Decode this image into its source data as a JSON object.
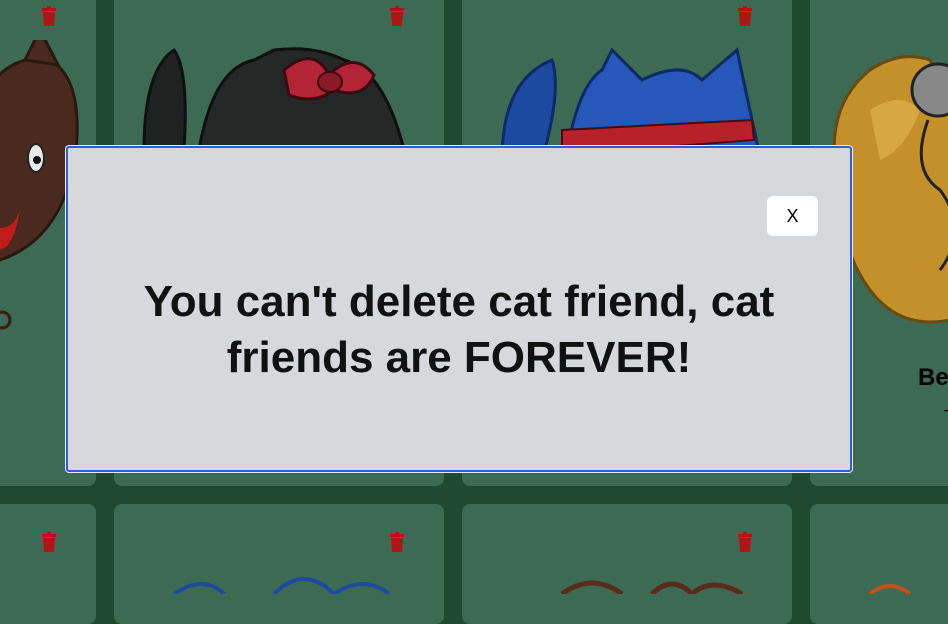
{
  "cards": [
    {
      "name": "",
      "subtitle": ""
    },
    {
      "name": "",
      "subtitle": ""
    },
    {
      "name": "",
      "subtitle": ""
    },
    {
      "name": "Be",
      "subtitle": "T"
    }
  ],
  "modal": {
    "close_label": "X",
    "message": "You can't delete cat friend, cat friends are FOREVER!"
  },
  "colors": {
    "background": "#1f4a30",
    "card": "#3c6a52",
    "trash": "#b01515",
    "modal_bg": "#d6d8dc",
    "modal_border": "#2d5fd0"
  },
  "icons": [
    "trash-icon",
    "close-icon"
  ]
}
